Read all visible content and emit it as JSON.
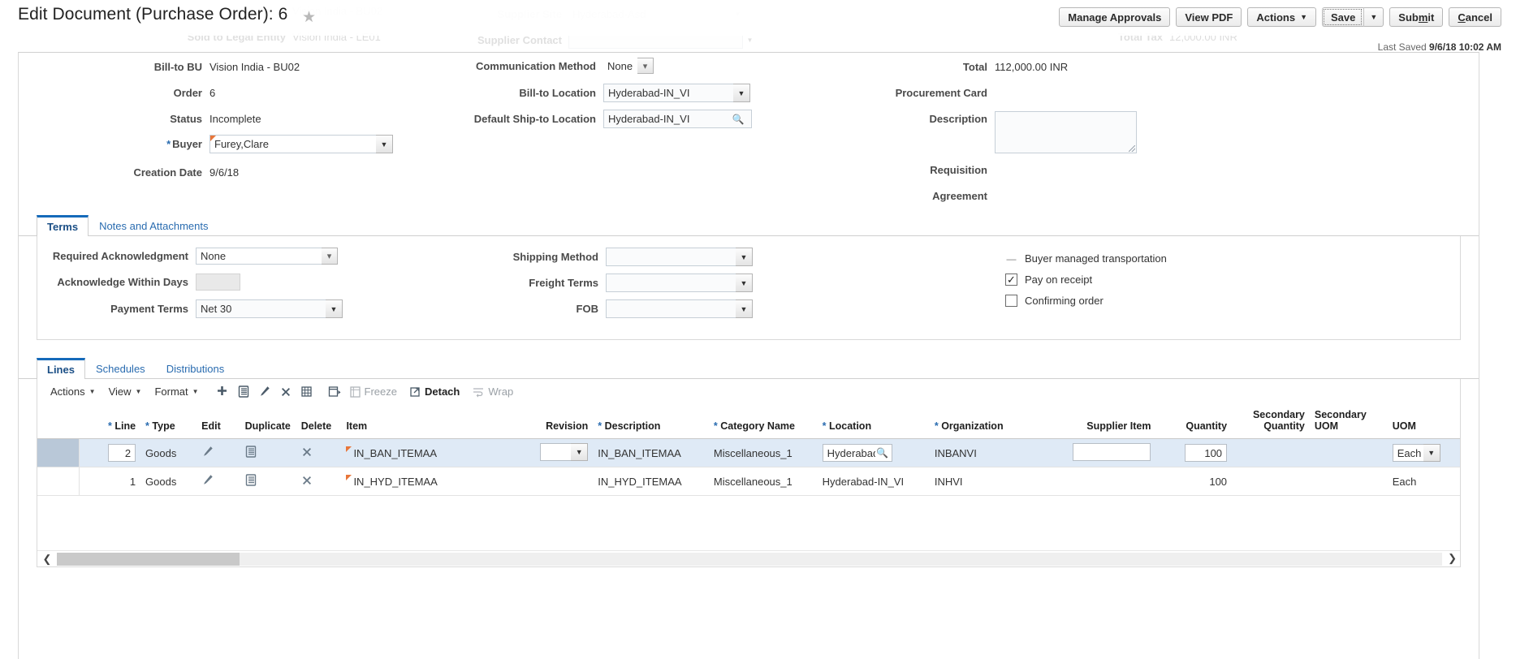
{
  "window": {
    "title": "Edit Document (Purchase Order): 6",
    "star_icon": "star-icon",
    "last_saved_label": "Last Saved",
    "last_saved_value": "9/6/18 10:02 AM"
  },
  "toolbar_buttons": {
    "manage_approvals": "Manage Approvals",
    "view_pdf": "View PDF",
    "actions": "Actions",
    "save": "Save",
    "submit_pre": "Sub",
    "submit_underline": "m",
    "submit_post": "it",
    "cancel_underline": "C",
    "cancel_post": "ancel",
    "caret": "▼"
  },
  "faded_header": {
    "supplier_site_label": "Supplier Site",
    "supplier_site_value": "Hyderabad-Asd",
    "supplier_contact_label": "Supplier Contact",
    "sold_to_legal_entity_label": "Sold to Legal Entity",
    "sold_to_legal_entity_value": "Vision India - LE01",
    "bill_to_bu_faded_value": "Vision India - BU02",
    "total_tax_label": "Total Tax",
    "total_tax_value": "12,000.00 INR"
  },
  "header_form": {
    "left": [
      {
        "label": "Bill-to BU",
        "value": "Vision India - BU02"
      },
      {
        "label": "Order",
        "value": "6"
      },
      {
        "label": "Status",
        "value": "Incomplete"
      },
      {
        "label": "Buyer",
        "value": "Furey,Clare",
        "required": true
      },
      {
        "label": "Creation Date",
        "value": "9/6/18"
      }
    ],
    "middle": [
      {
        "label": "Communication Method",
        "value": "None"
      },
      {
        "label": "Bill-to Location",
        "value": "Hyderabad-IN_VI"
      },
      {
        "label": "Default Ship-to Location",
        "value": "Hyderabad-IN_VI"
      }
    ],
    "right": [
      {
        "label": "Total",
        "value": "112,000.00 INR"
      },
      {
        "label": "Procurement Card",
        "value": ""
      },
      {
        "label": "Description",
        "value": ""
      },
      {
        "label": "Requisition",
        "value": ""
      },
      {
        "label": "Agreement",
        "value": ""
      }
    ]
  },
  "upper_tabs": [
    {
      "label": "Terms",
      "active": true
    },
    {
      "label": "Notes and Attachments",
      "active": false
    }
  ],
  "terms": {
    "left": [
      {
        "label": "Required Acknowledgment",
        "value": "None"
      },
      {
        "label": "Acknowledge Within Days",
        "value": ""
      },
      {
        "label": "Payment Terms",
        "value": "Net 30"
      }
    ],
    "middle": [
      {
        "label": "Shipping Method",
        "value": ""
      },
      {
        "label": "Freight Terms",
        "value": ""
      },
      {
        "label": "FOB",
        "value": ""
      }
    ],
    "checkboxes": [
      {
        "label": "Buyer managed transportation",
        "state": "disabled"
      },
      {
        "label": "Pay on receipt",
        "state": "checked"
      },
      {
        "label": "Confirming order",
        "state": "unchecked"
      }
    ]
  },
  "lower_tabs": [
    {
      "label": "Lines",
      "active": true
    },
    {
      "label": "Schedules",
      "active": false
    },
    {
      "label": "Distributions",
      "active": false
    }
  ],
  "lines_toolbar": {
    "menus": [
      "Actions",
      "View",
      "Format"
    ],
    "icons": [
      {
        "name": "add-icon",
        "glyph": "✚"
      },
      {
        "name": "duplicate-icon",
        "glyph": "⌸"
      },
      {
        "name": "edit-pencil-icon",
        "glyph": "✐"
      },
      {
        "name": "delete-x-icon",
        "glyph": "✖"
      },
      {
        "name": "split-line-icon",
        "glyph": "♯"
      },
      {
        "name": "export-icon",
        "glyph": "☷"
      }
    ],
    "freeze": "Freeze",
    "detach": "Detach",
    "wrap": "Wrap"
  },
  "lines_table": {
    "columns": [
      {
        "key": "line",
        "label": "Line",
        "required": true,
        "align": "right"
      },
      {
        "key": "type",
        "label": "Type",
        "required": true,
        "align": "left"
      },
      {
        "key": "edit",
        "label": "Edit",
        "required": false,
        "align": "left"
      },
      {
        "key": "duplicate",
        "label": "Duplicate",
        "required": false,
        "align": "left"
      },
      {
        "key": "delete",
        "label": "Delete",
        "required": false,
        "align": "left"
      },
      {
        "key": "item",
        "label": "Item",
        "required": false,
        "align": "left"
      },
      {
        "key": "revision",
        "label": "Revision",
        "required": false,
        "align": "right"
      },
      {
        "key": "description",
        "label": "Description",
        "required": true,
        "align": "left"
      },
      {
        "key": "category_name",
        "label": "Category Name",
        "required": true,
        "align": "left"
      },
      {
        "key": "location",
        "label": "Location",
        "required": true,
        "align": "left"
      },
      {
        "key": "organization",
        "label": "Organization",
        "required": true,
        "align": "left"
      },
      {
        "key": "supplier_item",
        "label": "Supplier Item",
        "required": false,
        "align": "right"
      },
      {
        "key": "quantity",
        "label": "Quantity",
        "required": false,
        "align": "right"
      },
      {
        "key": "secondary_quantity",
        "label": "Secondary Quantity",
        "required": false,
        "align": "right"
      },
      {
        "key": "secondary_uom",
        "label": "Secondary UOM",
        "required": false,
        "align": "left"
      },
      {
        "key": "uom",
        "label": "UOM",
        "required": false,
        "align": "left"
      }
    ],
    "rows": [
      {
        "selected": true,
        "editable": true,
        "line": "2",
        "type": "Goods",
        "item": "IN_BAN_ITEMAA",
        "revision": "",
        "description": "IN_BAN_ITEMAA",
        "category_name": "Miscellaneous_1",
        "location": "Hyderabad-I",
        "organization": "INBANVI",
        "supplier_item": "",
        "quantity": "100",
        "secondary_quantity": "",
        "secondary_uom": "",
        "uom": "Each"
      },
      {
        "selected": false,
        "editable": false,
        "line": "1",
        "type": "Goods",
        "item": "IN_HYD_ITEMAA",
        "revision": "",
        "description": "IN_HYD_ITEMAA",
        "category_name": "Miscellaneous_1",
        "location": "Hyderabad-IN_VI",
        "organization": "INHVI",
        "supplier_item": "",
        "quantity": "100",
        "secondary_quantity": "",
        "secondary_uom": "",
        "uom": "Each"
      }
    ]
  },
  "scrollbar": {
    "left_arrow": "‹",
    "right_arrow": "›"
  },
  "colors": {
    "accent_blue": "#156aba",
    "link_blue": "#2a6cb0",
    "row_selected": "#dfeaf6",
    "flag_orange": "#e8763a"
  }
}
